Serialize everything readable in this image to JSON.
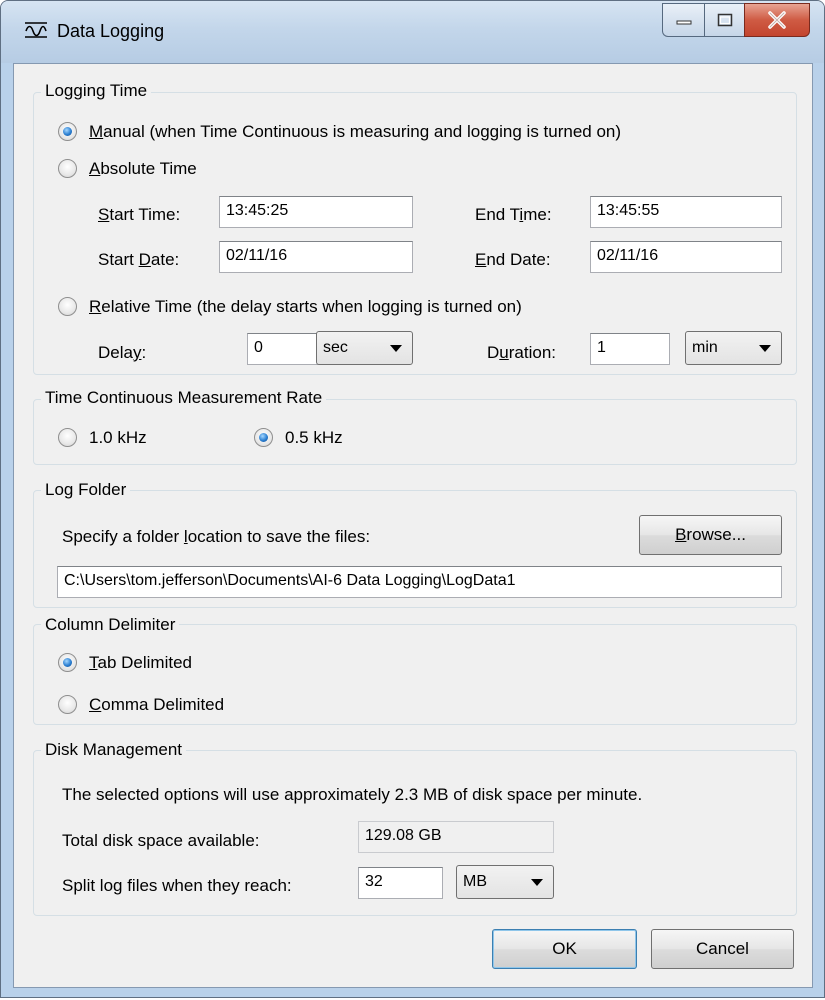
{
  "window": {
    "title": "Data Logging",
    "close_color": "#c7472f",
    "accent": "#3c7fb1"
  },
  "logging_time": {
    "group_label": "Logging Time",
    "manual": {
      "prefix": "",
      "accel": "M",
      "rest": "anual (when Time Continuous is measuring and logging is turned on)",
      "checked": true
    },
    "absolute": {
      "accel": "A",
      "rest": "bsolute Time",
      "checked": false
    },
    "start_time": {
      "accel": "S",
      "rest": "tart Time:",
      "value": "13:45:25"
    },
    "end_time": {
      "pre": "End T",
      "accel": "i",
      "rest": "me:",
      "value": "13:45:55"
    },
    "start_date": {
      "pre": "Start ",
      "accel": "D",
      "rest": "ate:",
      "value": "02/11/16"
    },
    "end_date": {
      "accel": "E",
      "rest": "nd Date:",
      "value": "02/11/16"
    },
    "relative": {
      "accel": "R",
      "rest": "elative Time (the delay starts when logging is turned on)",
      "checked": false
    },
    "delay": {
      "pre": "Dela",
      "accel": "y",
      "rest": ":",
      "value": "0",
      "unit": "sec"
    },
    "duration": {
      "pre": "D",
      "accel": "u",
      "rest": "ration:",
      "value": "1",
      "unit": "min"
    }
  },
  "measurement_rate": {
    "group_label": "Time Continuous Measurement Rate",
    "options": [
      {
        "label": "1.0 kHz",
        "checked": false
      },
      {
        "label": "0.5 kHz",
        "checked": true
      }
    ]
  },
  "log_folder": {
    "group_label": "Log Folder",
    "prompt": {
      "pre": "Specify a folder ",
      "accel": "l",
      "rest": "ocation to save the files:"
    },
    "browse": {
      "accel": "B",
      "rest": "rowse..."
    },
    "path": "C:\\Users\\tom.jefferson\\Documents\\AI-6 Data Logging\\LogData1"
  },
  "column_delimiter": {
    "group_label": "Column Delimiter",
    "tab": {
      "accel": "T",
      "rest": "ab Delimited",
      "checked": true
    },
    "comma": {
      "accel": "C",
      "rest": "omma Delimited",
      "checked": false
    }
  },
  "disk_management": {
    "group_label": "Disk Management",
    "usage_text": "The selected options will use approximately 2.3 MB of disk space per minute.",
    "available_label": "Total disk space available:",
    "available_value": "129.08 GB",
    "split_label": "Split log files when they reach:",
    "split_value": "32",
    "split_unit": "MB"
  },
  "footer": {
    "ok": "OK",
    "cancel": "Cancel"
  }
}
